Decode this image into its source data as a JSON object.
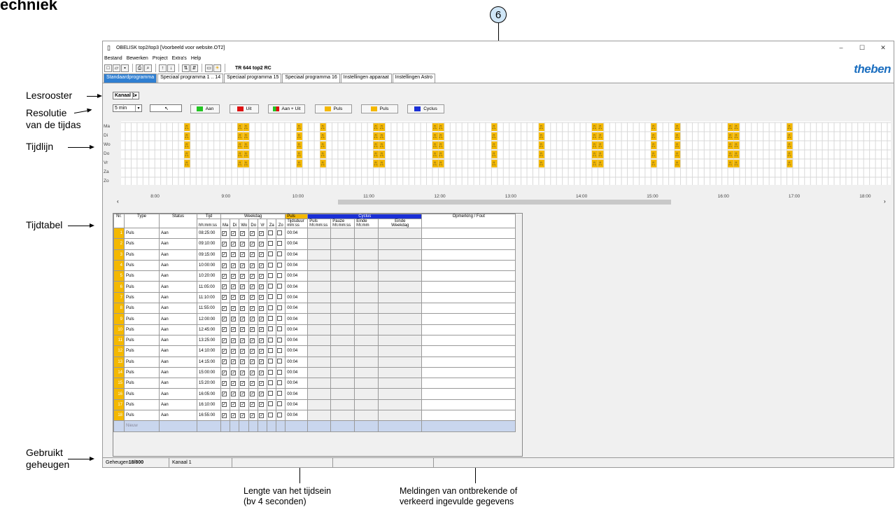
{
  "page": {
    "heading": "echniek",
    "callout_number": "6"
  },
  "annotations": {
    "lesrooster": "Lesrooster",
    "resolutie": "Resolutie\nvan de tijdas",
    "tijdlijn": "Tijdlijn",
    "tijdtabel": "Tijdtabel",
    "gebruikt": "Gebruikt\ngeheugen",
    "lengte": "Lengte van het tijdsein\n(bv 4 seconden)",
    "meldingen": "Meldingen van ontbrekende of\nverkeerd ingevulde gegevens"
  },
  "window": {
    "title": "OBELISK top2/top3    [Voorbeeld voor website.OT2]",
    "controls": [
      "–",
      "☐",
      "✕"
    ],
    "menu": [
      "Bestand",
      "Bewerken",
      "Project",
      "Extra's",
      "Help"
    ],
    "device": "TR 644 top2 RC",
    "logo": "theben",
    "tabs": [
      "Standaardprogramma",
      "Speciaal programma 1 .. 14",
      "Speciaal programma 15",
      "Speciaal programma 16",
      "Instellingen apparaat",
      "Instellingen Astro"
    ],
    "channel_select": "Kanaal  1",
    "resolution_select": "5 min",
    "legend": [
      {
        "label": "Aan",
        "color": "#22c522"
      },
      {
        "label": "Uit",
        "color": "#dd1111"
      },
      {
        "label": "Aan + Uit",
        "color": "#22c522"
      },
      {
        "label": "Puls",
        "color": "#f4b800"
      },
      {
        "label": "Puls",
        "color": "#f4b800"
      },
      {
        "label": "Cyclus",
        "color": "#1a2fd6"
      }
    ]
  },
  "timeline": {
    "days": [
      "Ma",
      "Di",
      "Wo",
      "Do",
      "Vr",
      "Za",
      "Zo"
    ],
    "hours": [
      "8:00",
      "9:00",
      "10:00",
      "11:00",
      "12:00",
      "13:00",
      "14:00",
      "15:00",
      "16:00",
      "17:00",
      "18:00"
    ],
    "pulse_color": "#f4b800"
  },
  "table": {
    "headers": {
      "nr": "Nr.",
      "type": "Type",
      "status": "Status",
      "tijd": "Tijd",
      "tijd_sub": "hh:mm:ss",
      "weekdag": "Weekdag",
      "days": [
        "Ma",
        "Di",
        "Wo",
        "Do",
        "Vr",
        "Za",
        "Zo"
      ],
      "puls": "Puls",
      "tijdsduur": "Tijdsduur",
      "tijdsduur_sub": "mm:ss",
      "cyclus": "Cyclus",
      "puls_c": "Puls",
      "puls_c_sub": "hh:mm:ss",
      "pauze": "Pauze",
      "pauze_sub": "hh:mm:ss",
      "einde": "Einde",
      "einde_sub": "hh:mm",
      "einde_wd": "Einde",
      "einde_wd_sub": "Weekdag",
      "opmerking": "Opmerking / Fout"
    },
    "rows": [
      {
        "nr": "1",
        "type": "Puls",
        "status": "Aan",
        "tijd": "08:25:00",
        "duur": "00:04"
      },
      {
        "nr": "2",
        "type": "Puls",
        "status": "Aan",
        "tijd": "09:10:00",
        "duur": "00:04"
      },
      {
        "nr": "3",
        "type": "Puls",
        "status": "Aan",
        "tijd": "09:15:00",
        "duur": "00:04"
      },
      {
        "nr": "4",
        "type": "Puls",
        "status": "Aan",
        "tijd": "10:00:00",
        "duur": "00:04"
      },
      {
        "nr": "5",
        "type": "Puls",
        "status": "Aan",
        "tijd": "10:20:00",
        "duur": "00:04"
      },
      {
        "nr": "6",
        "type": "Puls",
        "status": "Aan",
        "tijd": "11:05:00",
        "duur": "00:04"
      },
      {
        "nr": "7",
        "type": "Puls",
        "status": "Aan",
        "tijd": "11:10:00",
        "duur": "00:04"
      },
      {
        "nr": "8",
        "type": "Puls",
        "status": "Aan",
        "tijd": "11:55:00",
        "duur": "00:04"
      },
      {
        "nr": "9",
        "type": "Puls",
        "status": "Aan",
        "tijd": "12:00:00",
        "duur": "00:04"
      },
      {
        "nr": "10",
        "type": "Puls",
        "status": "Aan",
        "tijd": "12:45:00",
        "duur": "00:04"
      },
      {
        "nr": "11",
        "type": "Puls",
        "status": "Aan",
        "tijd": "13:25:00",
        "duur": "00:04"
      },
      {
        "nr": "12",
        "type": "Puls",
        "status": "Aan",
        "tijd": "14:10:00",
        "duur": "00:04"
      },
      {
        "nr": "13",
        "type": "Puls",
        "status": "Aan",
        "tijd": "14:15:00",
        "duur": "00:04"
      },
      {
        "nr": "14",
        "type": "Puls",
        "status": "Aan",
        "tijd": "15:00:00",
        "duur": "00:04"
      },
      {
        "nr": "15",
        "type": "Puls",
        "status": "Aan",
        "tijd": "15:20:00",
        "duur": "00:04"
      },
      {
        "nr": "16",
        "type": "Puls",
        "status": "Aan",
        "tijd": "16:05:00",
        "duur": "00:04"
      },
      {
        "nr": "17",
        "type": "Puls",
        "status": "Aan",
        "tijd": "16:10:00",
        "duur": "00:04"
      },
      {
        "nr": "18",
        "type": "Puls",
        "status": "Aan",
        "tijd": "16:55:00",
        "duur": "00:04"
      }
    ],
    "new_row": "Nieuw"
  },
  "statusbar": {
    "memory_label": "Geheugen ",
    "memory_value": "18/800",
    "channel": "Kanaal  1"
  }
}
